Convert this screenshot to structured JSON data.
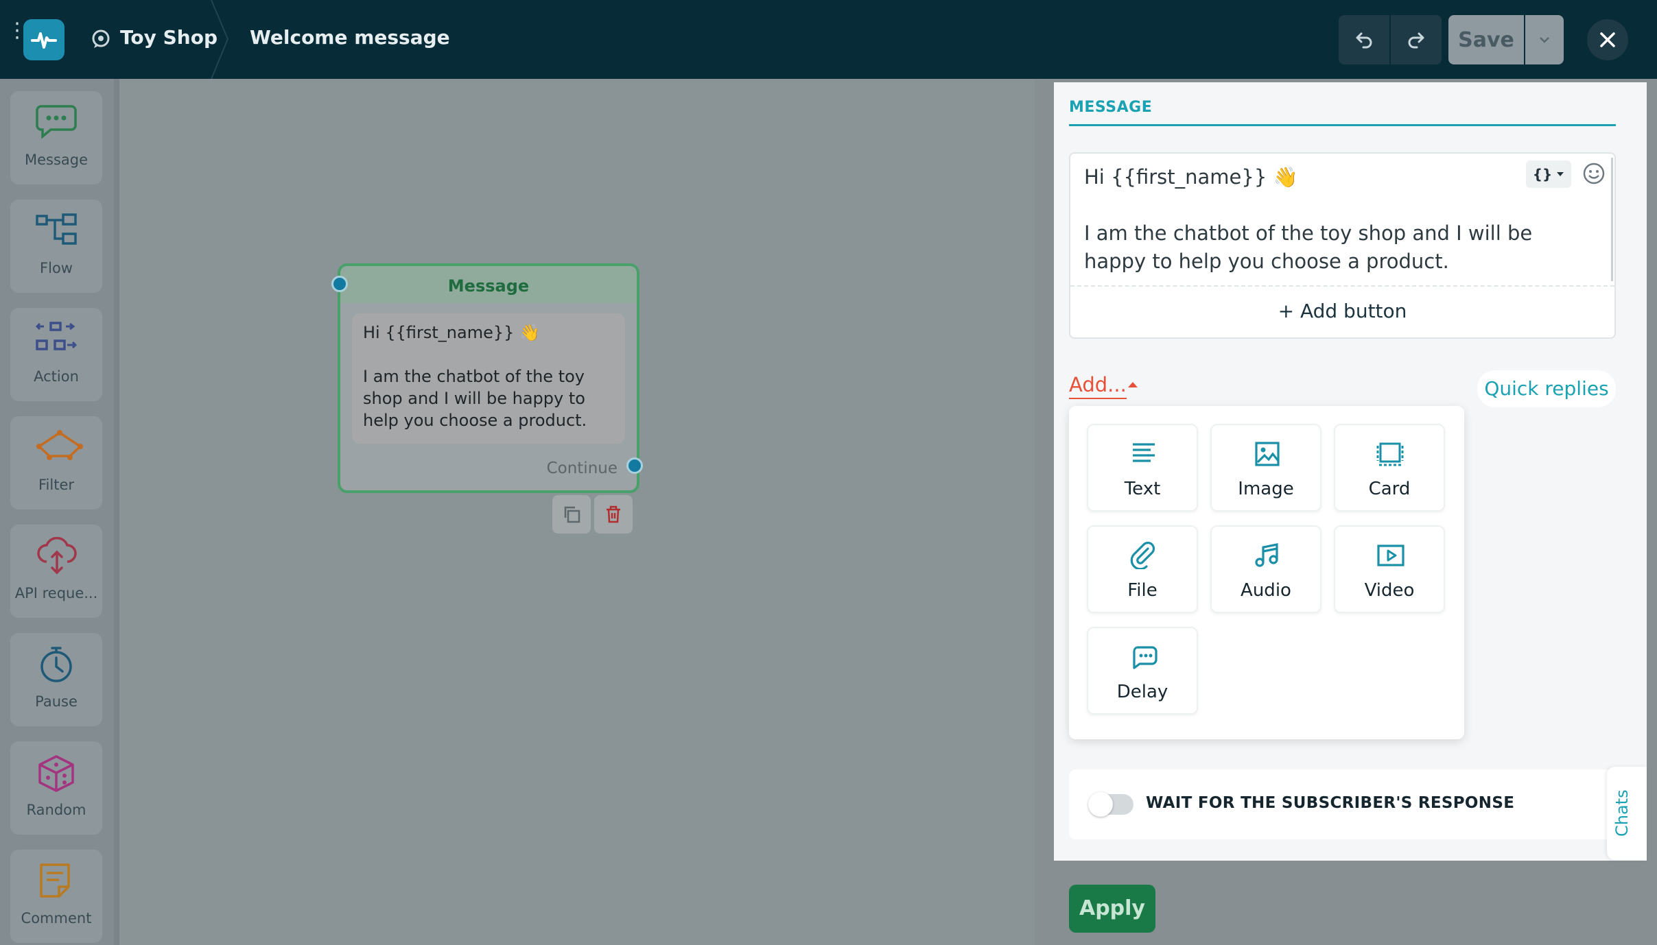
{
  "header": {
    "project_name": "Toy Shop",
    "flow_name": "Welcome message",
    "save_label": "Save"
  },
  "toolbox": {
    "items": [
      {
        "label": "Message",
        "icon": "message-bubble-icon",
        "color": "#2e9a57"
      },
      {
        "label": "Flow",
        "icon": "flow-icon",
        "color": "#1e6f93"
      },
      {
        "label": "Action",
        "icon": "action-icon",
        "color": "#3d4f8a"
      },
      {
        "label": "Filter",
        "icon": "filter-icon",
        "color": "#d77a28"
      },
      {
        "label": "API reque...",
        "icon": "api-cloud-icon",
        "color": "#b13a4a"
      },
      {
        "label": "Pause",
        "icon": "stopwatch-icon",
        "color": "#1e6f93"
      },
      {
        "label": "Random",
        "icon": "dice-icon",
        "color": "#b33b8c"
      },
      {
        "label": "Comment",
        "icon": "note-icon",
        "color": "#c98a2a"
      }
    ]
  },
  "canvas": {
    "node": {
      "title": "Message",
      "text": "Hi {{first_name}} 👋\n\nI am the chatbot of the toy shop and I will be happy to help you choose a product.",
      "continue_label": "Continue"
    }
  },
  "panel": {
    "section_title": "MESSAGE",
    "message_text": "Hi {{first_name}} 👋\n\nI am the chatbot of the toy shop and I will be happy to help you choose a product.",
    "variable_button": "{}",
    "add_button_label": "+ Add button",
    "add_menu_label": "Add...",
    "quick_replies_label": "Quick replies",
    "add_menu_items": [
      {
        "label": "Text",
        "icon": "text-lines-icon"
      },
      {
        "label": "Image",
        "icon": "image-icon"
      },
      {
        "label": "Card",
        "icon": "card-icon"
      },
      {
        "label": "File",
        "icon": "paperclip-icon"
      },
      {
        "label": "Audio",
        "icon": "music-note-icon"
      },
      {
        "label": "Video",
        "icon": "video-play-icon"
      },
      {
        "label": "Delay",
        "icon": "typing-bubble-icon"
      }
    ],
    "wait_label": "WAIT FOR THE SUBSCRIBER'S RESPONSE",
    "wait_enabled": false,
    "chats_tab_label": "Chats",
    "apply_label": "Apply"
  },
  "colors": {
    "topbar": "#082b38",
    "accent": "#1aa2b3",
    "add_link": "#e8503a",
    "apply": "#1a7a47"
  }
}
